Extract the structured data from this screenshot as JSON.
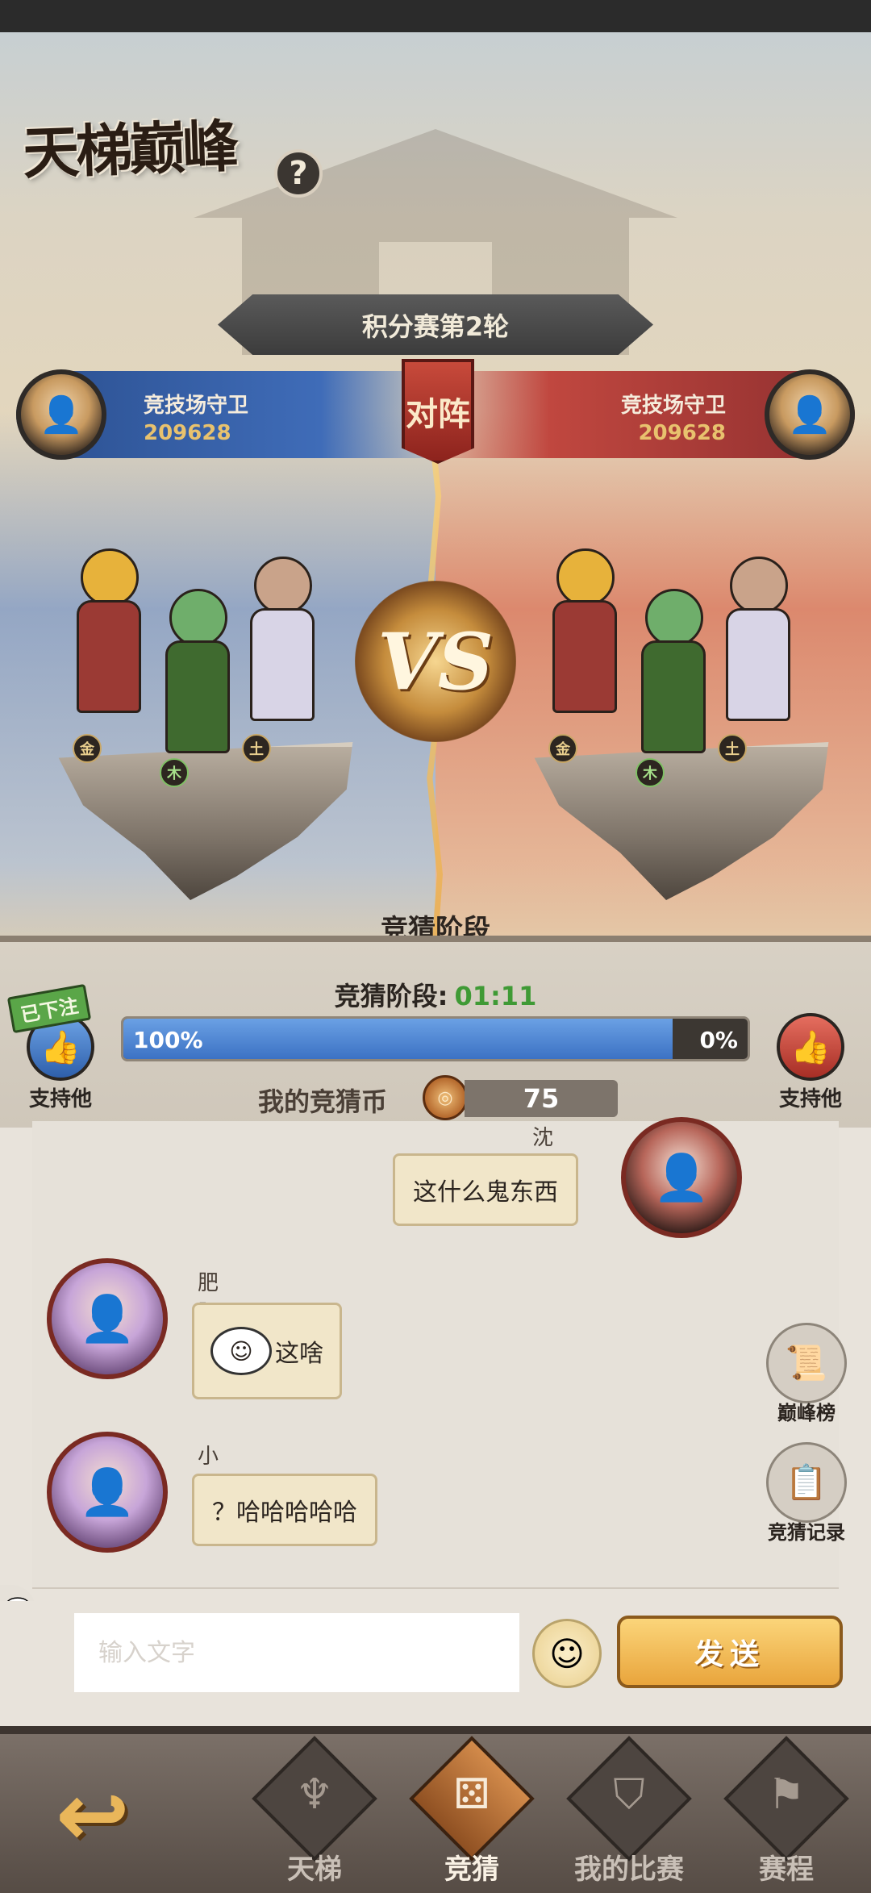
{
  "header": {
    "title": "天梯巅峰",
    "help_icon": "question-mark-icon",
    "round_title": "积分赛第2轮"
  },
  "match": {
    "left_player": {
      "name": "竞技场守卫",
      "score": "209628",
      "color": "#3f6cb8"
    },
    "right_player": {
      "name": "竞技场守卫",
      "score": "209628",
      "color": "#c0473f"
    },
    "vs_banner": "对阵",
    "vs_text": "VS",
    "left_team_elements": [
      "金",
      "木",
      "土"
    ],
    "right_team_elements": [
      "金",
      "木",
      "土"
    ]
  },
  "stage": {
    "label": "竞猜阶段",
    "timer_label": "竞猜阶段:",
    "timer": "01:11",
    "left_percent_text": "100%",
    "right_percent_text": "0%",
    "left_support_ratio": 1.0,
    "left_support_label": "支持他",
    "right_support_label": "支持他",
    "bet_placed_tag": "已下注",
    "coin_label": "我的竞猜币",
    "coin_value": "75"
  },
  "chat": {
    "messages": [
      {
        "user": "沈君",
        "text": "这什么鬼东西",
        "side": "right"
      },
      {
        "user": "肥肥虾",
        "text": "这啥",
        "has_emoji": true,
        "side": "left"
      },
      {
        "user": "小雾",
        "text": "？哈哈哈哈哈",
        "side": "left"
      }
    ],
    "side_buttons": [
      {
        "label": "巅峰榜",
        "icon": "scroll-icon"
      },
      {
        "label": "竞猜记录",
        "icon": "notebook-icon"
      }
    ],
    "input_placeholder": "输入文字",
    "send_label": "发送"
  },
  "nav": {
    "tabs": [
      {
        "label": "天梯",
        "icon": "ladder-emblem-icon",
        "active": false
      },
      {
        "label": "竞猜",
        "icon": "dice-icon",
        "active": true
      },
      {
        "label": "我的比赛",
        "icon": "shield-icon",
        "active": false
      },
      {
        "label": "赛程",
        "icon": "schedule-scroll-icon",
        "active": false
      }
    ]
  }
}
